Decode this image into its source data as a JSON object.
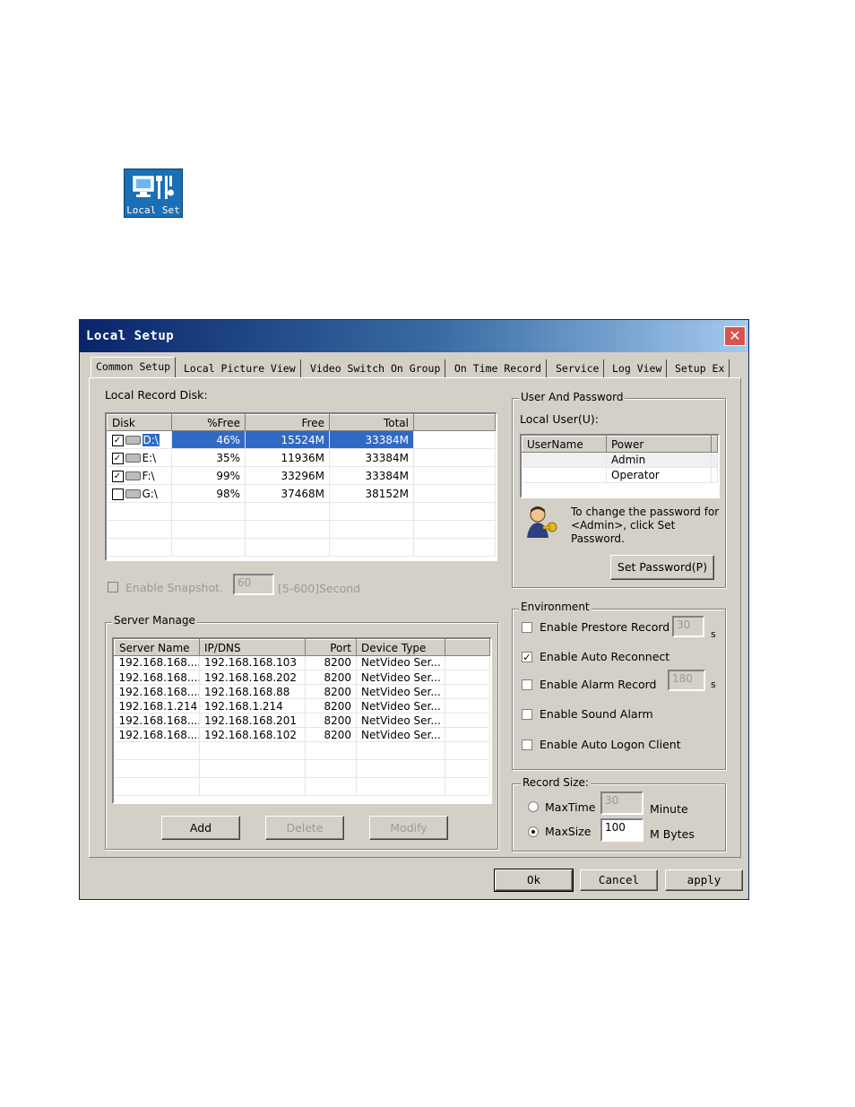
{
  "desktop_icon": {
    "label": "Local Set",
    "icon": "computer-settings-icon"
  },
  "window": {
    "title": "Local Setup",
    "close_label": "✕",
    "tabs": [
      "Common Setup",
      "Local Picture View",
      "Video Switch On Group",
      "On Time Record",
      "Service",
      "Log View",
      "Setup Ex"
    ],
    "active_tab": "Common Setup"
  },
  "local_record_disk": {
    "label": "Local Record Disk:",
    "columns": [
      "Disk",
      "%Free",
      "Free",
      "Total"
    ],
    "rows": [
      {
        "checked": "✓",
        "disk": "D:\\",
        "pct_free": "46%",
        "free": "15524M",
        "total": "33384M"
      },
      {
        "checked": "✓",
        "disk": "E:\\",
        "pct_free": "35%",
        "free": "11936M",
        "total": "33384M"
      },
      {
        "checked": "✓",
        "disk": "F:\\",
        "pct_free": "99%",
        "free": "33296M",
        "total": "33384M"
      },
      {
        "checked": "",
        "disk": "G:\\",
        "pct_free": "98%",
        "free": "37468M",
        "total": "38152M"
      }
    ]
  },
  "snapshot": {
    "label": "Enable Snapshot.",
    "value": "60",
    "range": "[5-600]Second"
  },
  "server_manage": {
    "title": "Server Manage",
    "columns": [
      "Server Name",
      "IP/DNS",
      "Port",
      "Device Type"
    ],
    "rows": [
      {
        "name": "192.168.168....",
        "ip": "192.168.168.103",
        "port": "8200",
        "type": "NetVideo Ser..."
      },
      {
        "name": "192.168.168....",
        "ip": "192.168.168.202",
        "port": "8200",
        "type": "NetVideo Ser..."
      },
      {
        "name": "192.168.168....",
        "ip": "192.168.168.88",
        "port": "8200",
        "type": "NetVideo Ser..."
      },
      {
        "name": "192.168.1.214",
        "ip": "192.168.1.214",
        "port": "8200",
        "type": "NetVideo Ser..."
      },
      {
        "name": "192.168.168....",
        "ip": "192.168.168.201",
        "port": "8200",
        "type": "NetVideo Ser..."
      },
      {
        "name": "192.168.168....",
        "ip": "192.168.168.102",
        "port": "8200",
        "type": "NetVideo Ser..."
      }
    ],
    "add_label": "Add",
    "delete_label": "Delete",
    "modify_label": "Modify"
  },
  "user_password": {
    "title": "User And Password",
    "local_user_label": "Local User(U):",
    "columns": [
      "UserName",
      "Power"
    ],
    "rows": [
      {
        "username": "",
        "power": "Admin"
      },
      {
        "username": "",
        "power": "Operator"
      }
    ],
    "hint": "To change the password for <Admin>, click Set Password.",
    "set_password_label": "Set Password(P)"
  },
  "environment": {
    "title": "Environment",
    "prestore": {
      "label": "Enable Prestore Record",
      "checked": "",
      "value": "30",
      "unit": "s"
    },
    "auto_reconnect": {
      "label": "Enable Auto Reconnect",
      "checked": "✓"
    },
    "alarm_record": {
      "label": "Enable Alarm Record",
      "checked": "",
      "value": "180",
      "unit": "s"
    },
    "sound_alarm": {
      "label": "Enable Sound Alarm",
      "checked": ""
    },
    "auto_logon": {
      "label": "Enable Auto Logon Client",
      "checked": ""
    }
  },
  "record_size": {
    "title": "Record Size:",
    "maxtime": {
      "label": "MaxTime",
      "value": "30",
      "unit": "Minute"
    },
    "maxsize": {
      "label": "MaxSize",
      "value": "100",
      "unit": "M Bytes"
    },
    "selected": "MaxSize"
  },
  "footer": {
    "ok_label": "Ok",
    "cancel_label": "Cancel",
    "apply_label": "apply"
  }
}
